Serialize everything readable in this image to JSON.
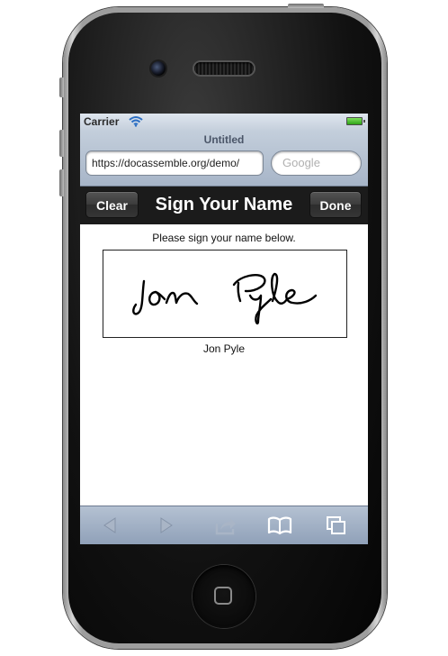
{
  "status_bar": {
    "carrier": "Carrier",
    "wifi_icon": "wifi-icon",
    "battery_icon": "battery-icon",
    "battery_color": "#2ea317"
  },
  "browser": {
    "page_title": "Untitled",
    "url": "https://docassemble.org/demo/",
    "search_placeholder": "Google"
  },
  "nav": {
    "clear_label": "Clear",
    "title": "Sign Your Name",
    "done_label": "Done"
  },
  "content": {
    "instructions": "Please sign your name below.",
    "signature_name": "Jon Pyle"
  },
  "toolbar": {
    "icons": [
      "back-icon",
      "forward-icon",
      "share-icon",
      "bookmarks-icon",
      "tabs-icon"
    ]
  },
  "colors": {
    "nav_bar": "#1b1b1b",
    "safari_chrome": "#a7b5c8"
  }
}
